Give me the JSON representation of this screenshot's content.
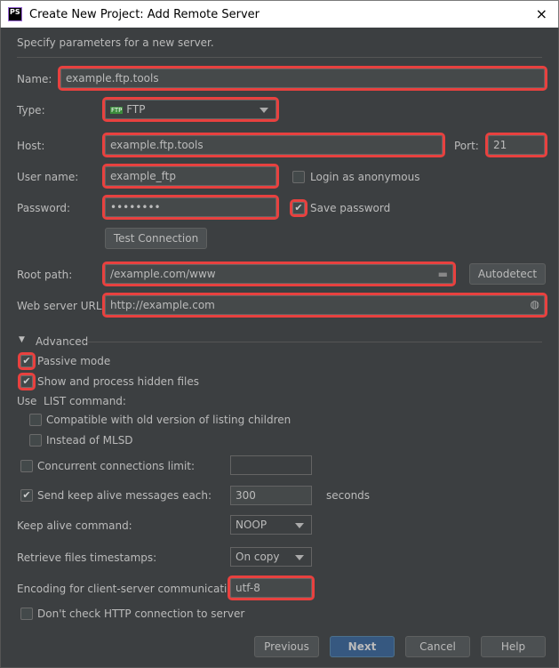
{
  "window": {
    "title": "Create New Project: Add Remote Server",
    "logo": "PS",
    "close_icon": "×"
  },
  "intro": "Specify parameters for a new server.",
  "name": {
    "label": "Name:",
    "value": "example.ftp.tools"
  },
  "type": {
    "label": "Type:",
    "value": "FTP",
    "icon": "ftp-icon",
    "icon_text": "FTP"
  },
  "host": {
    "label": "Host:",
    "value": "example.ftp.tools"
  },
  "port": {
    "label": "Port:",
    "value": "21"
  },
  "user": {
    "label": "User name:",
    "value": "example_ftp"
  },
  "anonymous": {
    "label": "Login as anonymous",
    "checked": false
  },
  "password": {
    "label": "Password:",
    "value": "••••••••"
  },
  "save_password": {
    "label": "Save password",
    "checked": true
  },
  "test_connection": "Test Connection",
  "root_path": {
    "label": "Root path:",
    "value": "/example.com/www"
  },
  "autodetect": "Autodetect",
  "web_url": {
    "label": "Web server URL:",
    "value": "http://example.com"
  },
  "advanced": {
    "title": "Advanced",
    "passive": {
      "label": "Passive mode",
      "checked": true
    },
    "hidden": {
      "label": "Show and process hidden files",
      "checked": true
    },
    "list_label": "Use  LIST command:",
    "compatible": {
      "label": "Compatible with old version of listing children",
      "checked": false
    },
    "mlsd": {
      "label": "Instead of MLSD",
      "checked": false
    },
    "concurrent": {
      "label": "Concurrent connections limit:",
      "checked": false,
      "value": ""
    },
    "keepalive": {
      "label": "Send keep alive messages each:",
      "checked": true,
      "value": "300",
      "unit": "seconds"
    },
    "keepalive_cmd": {
      "label": "Keep alive command:",
      "value": "NOOP"
    },
    "timestamps": {
      "label": "Retrieve files timestamps:",
      "value": "On copy"
    },
    "encoding": {
      "label": "Encoding for client-server communication:",
      "value": "utf-8"
    },
    "http_check": {
      "label": "Don't check HTTP connection to server",
      "checked": false
    }
  },
  "buttons": {
    "previous": "Previous",
    "next": "Next",
    "cancel": "Cancel",
    "help": "Help"
  },
  "check_mark": "✔",
  "highlight_color": "#e8413f"
}
